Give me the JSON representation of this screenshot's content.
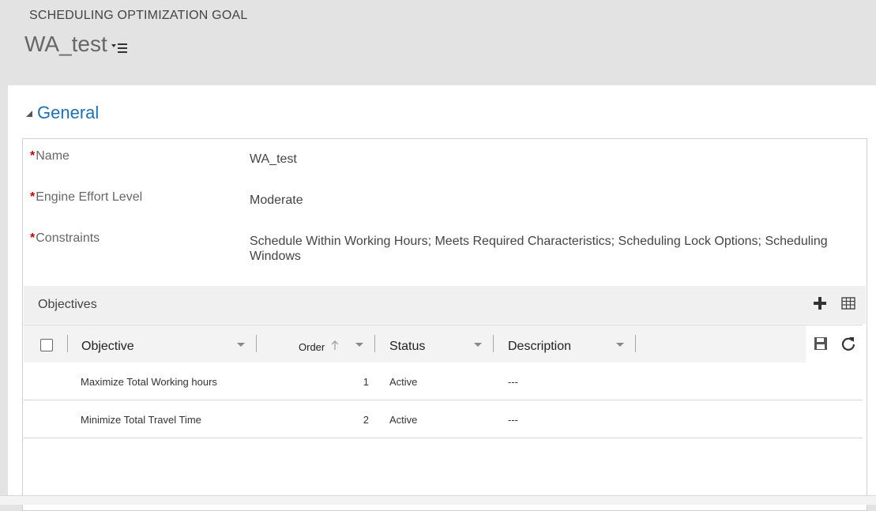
{
  "header": {
    "entity_type": "SCHEDULING OPTIMIZATION GOAL",
    "record_name": "WA_test",
    "menu_icon": "record-menu-icon"
  },
  "section": {
    "title": "General",
    "toggle_icon": "triangle-collapse-icon"
  },
  "fields": [
    {
      "label": "Name",
      "value": "WA_test",
      "required": true
    },
    {
      "label": "Engine Effort Level",
      "value": "Moderate",
      "required": true
    },
    {
      "label": "Constraints",
      "value": "Schedule Within Working Hours; Meets Required Characteristics; Scheduling Lock Options; Scheduling Windows",
      "required": true
    }
  ],
  "required_marker": "*",
  "subgrid": {
    "title": "Objectives",
    "add_icon": "plus-icon",
    "view_icon": "grid-view-icon",
    "save_icon": "save-icon",
    "refresh_icon": "refresh-icon",
    "columns": [
      {
        "label": "Objective"
      },
      {
        "label": "Order",
        "sort": "ascending"
      },
      {
        "label": "Status"
      },
      {
        "label": "Description"
      }
    ],
    "rows": [
      {
        "objective": "Maximize Total Working hours",
        "order": "1",
        "status": "Active",
        "description": "---"
      },
      {
        "objective": "Minimize Total Travel Time",
        "order": "2",
        "status": "Active",
        "description": "---"
      }
    ]
  },
  "colors": {
    "accent": "#1f6fb5",
    "required": "#c00000",
    "header_bg": "#e3e3e3"
  }
}
